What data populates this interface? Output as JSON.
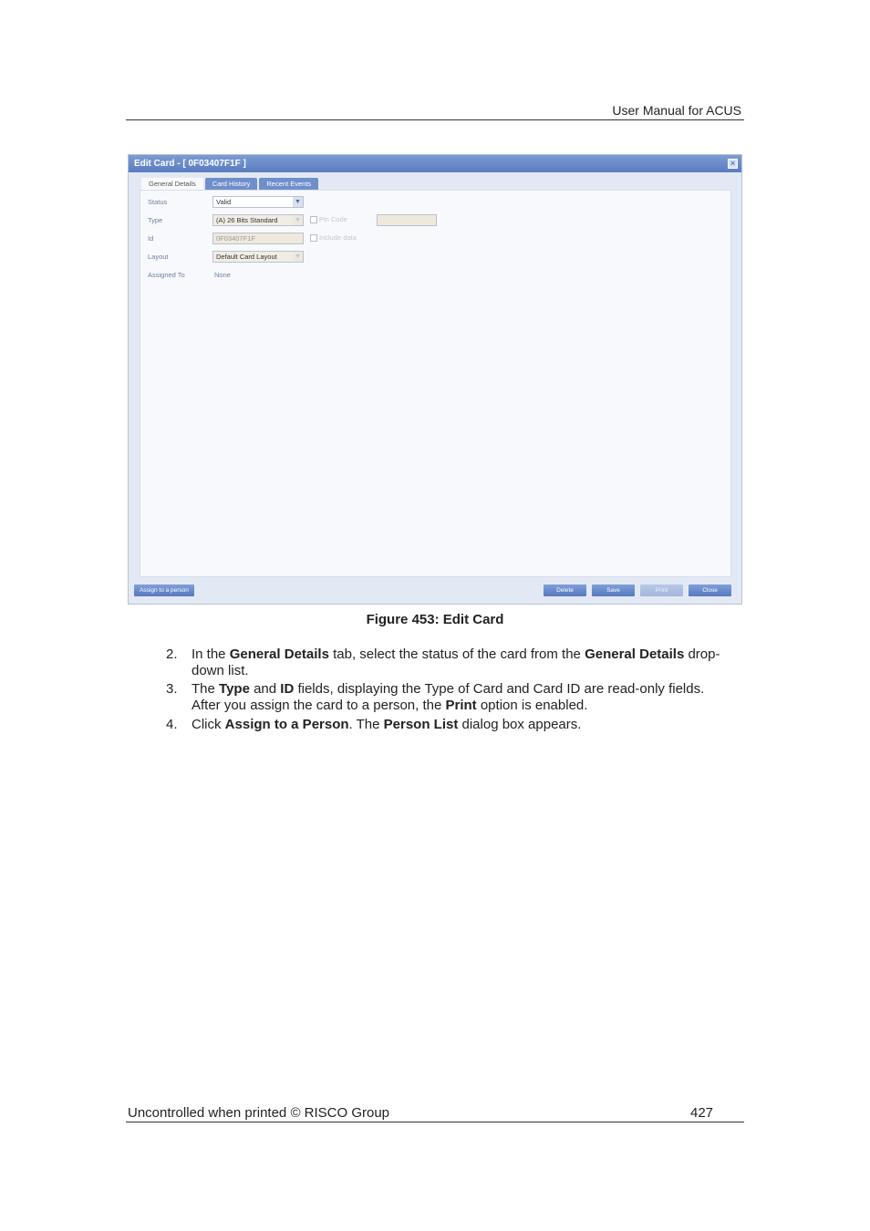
{
  "header": {
    "title": "User Manual for ACUS"
  },
  "dialog": {
    "title": "Edit Card - [ 0F03407F1F ]",
    "close_glyph": "×",
    "tabs": [
      "General Details",
      "Card History",
      "Recent Events"
    ],
    "fields": {
      "status": {
        "label": "Status",
        "value": "Valid"
      },
      "type": {
        "label": "Type",
        "value": "(A) 26 Bits Standard"
      },
      "id": {
        "label": "Id",
        "value": "0F03407F1F"
      },
      "layout": {
        "label": "Layout",
        "value": "Default Card Layout"
      },
      "assigned_to": {
        "label": "Assigned To",
        "value": "None"
      }
    },
    "checkboxes": {
      "pin_code": "Pin Code",
      "include_data": "Include data"
    },
    "buttons": {
      "assign": "Assign to a person",
      "delete": "Delete",
      "save": "Save",
      "print": "Print",
      "close": "Close"
    }
  },
  "caption": "Figure 453: Edit Card",
  "steps": [
    {
      "number": "2.",
      "line1": [
        "In the ",
        "General Details",
        " tab, select the status of the card from the ",
        "General Details",
        " drop-"
      ],
      "line2": "down list."
    },
    {
      "number": "3.",
      "line1": [
        "The ",
        "Type",
        " and ",
        "ID",
        " fields, displaying the Type of Card and Card ID are read-only fields."
      ],
      "line2": [
        "After you assign the card to a person, the ",
        "Print",
        " option is enabled."
      ]
    },
    {
      "number": "4.",
      "line1": [
        "Click ",
        "Assign to a Person",
        ". The ",
        "Person List",
        " dialog box appears."
      ]
    }
  ],
  "footer": {
    "left": "Uncontrolled when printed © RISCO Group",
    "page": "427"
  }
}
